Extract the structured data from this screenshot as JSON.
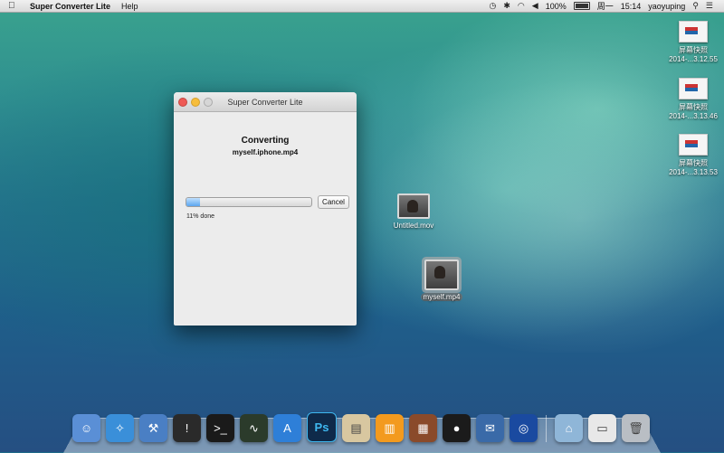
{
  "menubar": {
    "app_name": "Super Converter Lite",
    "menus": [
      "Help"
    ],
    "battery": "100%",
    "day": "周一",
    "time": "15:14",
    "user": "yaoyuping"
  },
  "desktop_icons": [
    {
      "title": "屏幕快照",
      "subtitle": "2014-...3.12.55"
    },
    {
      "title": "屏幕快照",
      "subtitle": "2014-...3.13.46"
    },
    {
      "title": "屏幕快照",
      "subtitle": "2014-...3.13.53"
    }
  ],
  "videos": [
    {
      "label": "Untitled.mov"
    },
    {
      "label": "myself.mp4"
    }
  ],
  "window": {
    "title": "Super Converter Lite",
    "heading": "Converting",
    "filename": "myself.iphone.mp4",
    "progress": 0.11,
    "status": "11% done",
    "cancel_label": "Cancel"
  },
  "dock": {
    "items": [
      {
        "name": "finder-icon",
        "color": "#5a8fd6",
        "glyph": "☺"
      },
      {
        "name": "safari-icon",
        "color": "#3a8fd9",
        "glyph": "✧"
      },
      {
        "name": "xcode-icon",
        "color": "#4a7fc4",
        "glyph": "⚒"
      },
      {
        "name": "console-icon",
        "color": "#2a2a2a",
        "glyph": "!"
      },
      {
        "name": "terminal-icon",
        "color": "#1a1a1a",
        "glyph": ">_"
      },
      {
        "name": "activity-monitor-icon",
        "color": "#2b3b2b",
        "glyph": "∿"
      },
      {
        "name": "app-store-icon",
        "color": "#2e7fd8",
        "glyph": "A"
      },
      {
        "name": "photoshop-icon",
        "color": "#0f2a4a",
        "glyph": "Ps"
      },
      {
        "name": "preview-icon",
        "color": "#d8c7a0",
        "glyph": "▤"
      },
      {
        "name": "ibooks-icon",
        "color": "#f39a1e",
        "glyph": "▥"
      },
      {
        "name": "photo-booth-icon",
        "color": "#8a4a2a",
        "glyph": "▦"
      },
      {
        "name": "qq-icon",
        "color": "#1b1b1b",
        "glyph": "●"
      },
      {
        "name": "mail-stamp-icon",
        "color": "#3a6aa8",
        "glyph": "✉"
      },
      {
        "name": "network-utility-icon",
        "color": "#1a4aa0",
        "glyph": "◎"
      },
      {
        "name": "downloads-folder-icon",
        "color": "#8fb6d8",
        "glyph": "⌂"
      },
      {
        "name": "documents-stack-icon",
        "color": "#e8e8e8",
        "glyph": "▭"
      },
      {
        "name": "trash-icon",
        "color": "#b9bec4",
        "glyph": "🗑"
      }
    ]
  }
}
